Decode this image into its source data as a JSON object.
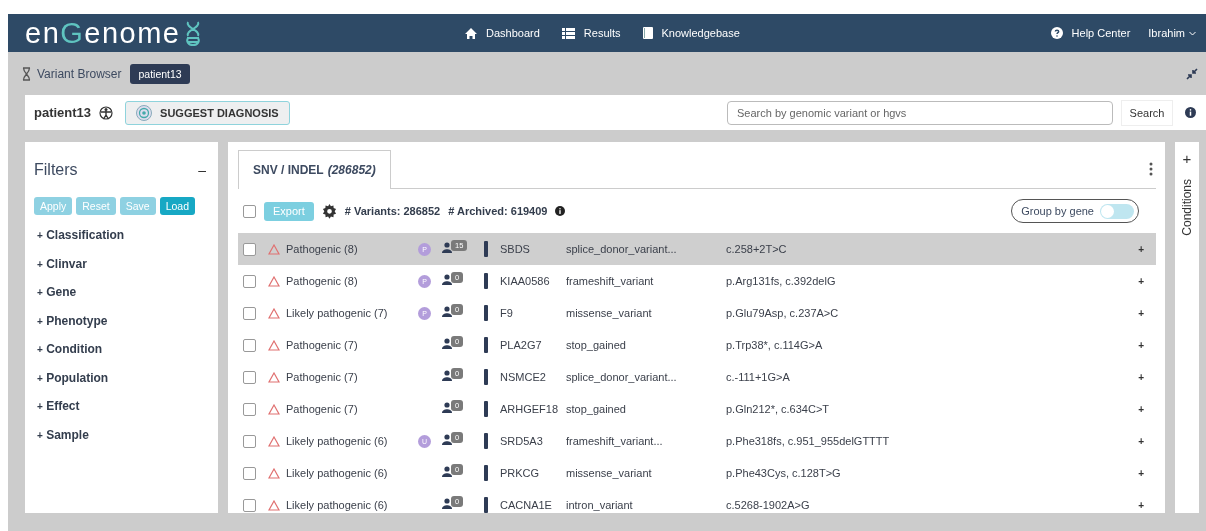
{
  "navbar": {
    "logo": {
      "parts": [
        {
          "text": "en",
          "accent": false
        },
        {
          "text": "G",
          "accent": true
        },
        {
          "text": "enome",
          "accent": false
        }
      ]
    },
    "links": [
      {
        "kind": "home",
        "label": "Dashboard"
      },
      {
        "kind": "list",
        "label": "Results"
      },
      {
        "kind": "book",
        "label": "Knowledgebase"
      }
    ],
    "help": "Help Center",
    "user": "Ibrahim"
  },
  "breadcrumb": {
    "label": "Variant Browser",
    "badge": "patient13"
  },
  "patient_bar": {
    "patient": "patient13",
    "suggest_button": "SUGGEST DIAGNOSIS",
    "search": {
      "placeholder": "Search by genomic variant or hgvs"
    },
    "search_button": "Search"
  },
  "filters": {
    "title": "Filters",
    "collapse": "–",
    "buttons": [
      {
        "label": "Apply",
        "disabled": true
      },
      {
        "label": "Reset",
        "disabled": true
      },
      {
        "label": "Save",
        "disabled": true
      },
      {
        "label": "Load",
        "disabled": false
      }
    ],
    "items": [
      {
        "sign": "+",
        "label": "Classification"
      },
      {
        "sign": "+",
        "label": "Clinvar"
      },
      {
        "sign": "+",
        "label": "Gene"
      },
      {
        "sign": "+",
        "label": "Phenotype"
      },
      {
        "sign": "+",
        "label": "Condition"
      },
      {
        "sign": "+",
        "label": "Population"
      },
      {
        "sign": "+",
        "label": "Effect"
      },
      {
        "sign": "+",
        "label": "Sample"
      }
    ]
  },
  "tabs": [
    {
      "label": "SNV / INDEL *(286852)*",
      "selected": true
    }
  ],
  "toolbar": {
    "checked": false,
    "export": "Export",
    "variants": "# Variants: 286852",
    "archived": "# Archived: 619409",
    "group_by_gene": {
      "label": "Group by gene",
      "on": false
    }
  },
  "rows": [
    {
      "selected": true,
      "checked": false,
      "classification": "Pathogenic (8)",
      "badge": "P",
      "count": "15",
      "gene": "SBDS",
      "effect": "splice_donor_variant...",
      "hgvs": "c.258+2T>C",
      "action": "+"
    },
    {
      "selected": false,
      "checked": false,
      "classification": "Pathogenic (8)",
      "badge": "P",
      "count": "0",
      "gene": "KIAA0586",
      "effect": "frameshift_variant",
      "hgvs": "p.Arg131fs, c.392delG",
      "action": "+"
    },
    {
      "selected": false,
      "checked": false,
      "classification": "Likely pathogenic (7)",
      "badge": "P",
      "count": "0",
      "gene": "F9",
      "effect": "missense_variant",
      "hgvs": "p.Glu79Asp, c.237A>C",
      "action": "+"
    },
    {
      "selected": false,
      "checked": false,
      "classification": "Pathogenic (7)",
      "count": "0",
      "gene": "PLA2G7",
      "effect": "stop_gained",
      "hgvs": "p.Trp38*, c.114G>A",
      "action": "+"
    },
    {
      "selected": false,
      "checked": false,
      "classification": "Pathogenic (7)",
      "count": "0",
      "gene": "NSMCE2",
      "effect": "splice_donor_variant...",
      "hgvs": "c.-111+1G>A",
      "action": "+"
    },
    {
      "selected": false,
      "checked": false,
      "classification": "Pathogenic (7)",
      "count": "0",
      "gene": "ARHGEF18",
      "effect": "stop_gained",
      "hgvs": "p.Gln212*, c.634C>T",
      "action": "+"
    },
    {
      "selected": false,
      "checked": false,
      "classification": "Likely pathogenic (6)",
      "badge": "U",
      "count": "0",
      "gene": "SRD5A3",
      "effect": "frameshift_variant...",
      "hgvs": "p.Phe318fs, c.951_955delGTTTT",
      "action": "+"
    },
    {
      "selected": false,
      "checked": false,
      "classification": "Likely pathogenic (6)",
      "count": "0",
      "gene": "PRKCG",
      "effect": "missense_variant",
      "hgvs": "p.Phe43Cys, c.128T>G",
      "action": "+"
    },
    {
      "selected": false,
      "checked": false,
      "classification": "Likely pathogenic (6)",
      "count": "0",
      "gene": "CACNA1E",
      "effect": "intron_variant",
      "hgvs": "c.5268-1902A>G",
      "action": "+"
    }
  ],
  "side_panel": {
    "add": "+",
    "label": "Conditions"
  }
}
